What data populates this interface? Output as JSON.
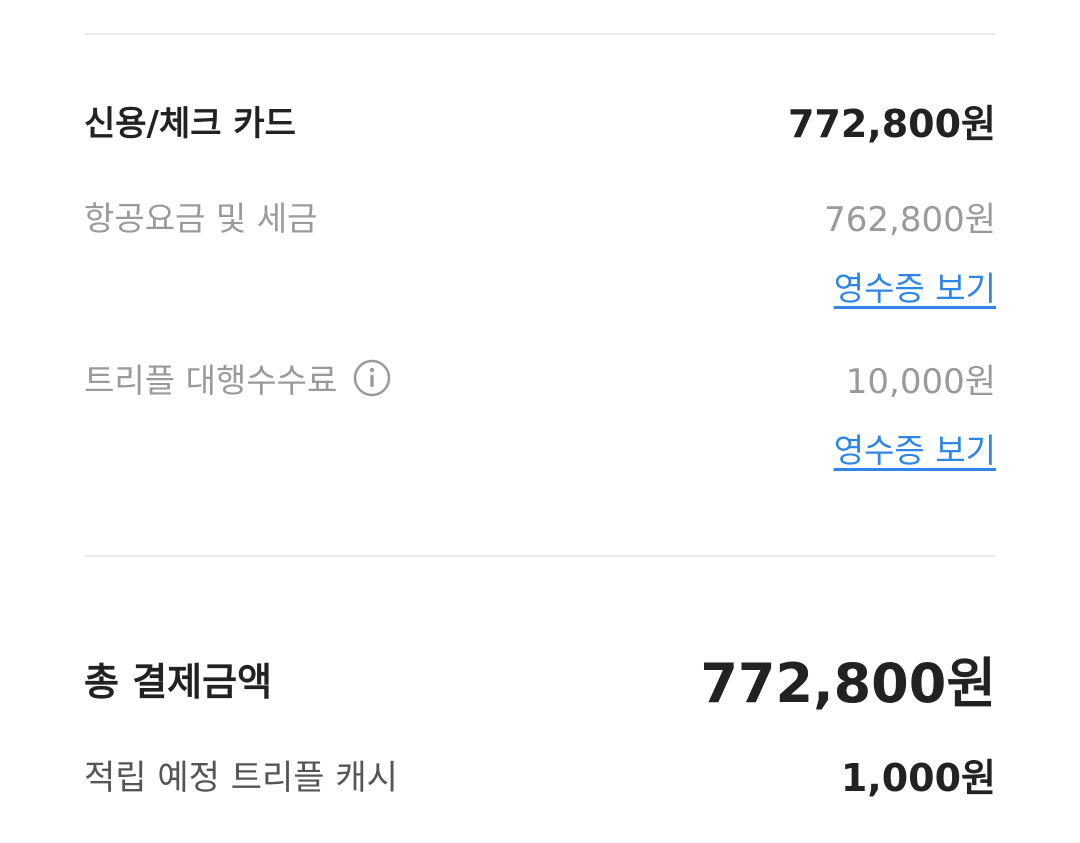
{
  "payment": {
    "method_label": "신용/체크 카드",
    "method_amount": "772,800원"
  },
  "items": [
    {
      "label": "항공요금 및 세금",
      "amount": "762,800원",
      "receipt_link": "영수증 보기"
    },
    {
      "label": "트리플 대행수수료",
      "amount": "10,000원",
      "receipt_link": "영수증 보기",
      "icon": "info-icon"
    }
  ],
  "summary": {
    "total_label": "총 결제금액",
    "total_amount": "772,800원",
    "cash_label": "적립 예정 트리플 캐시",
    "cash_amount": "1,000원"
  },
  "colors": {
    "link": "#2f86e6",
    "muted": "#9a9a9a",
    "strong": "#222222",
    "divider": "#ececec"
  }
}
